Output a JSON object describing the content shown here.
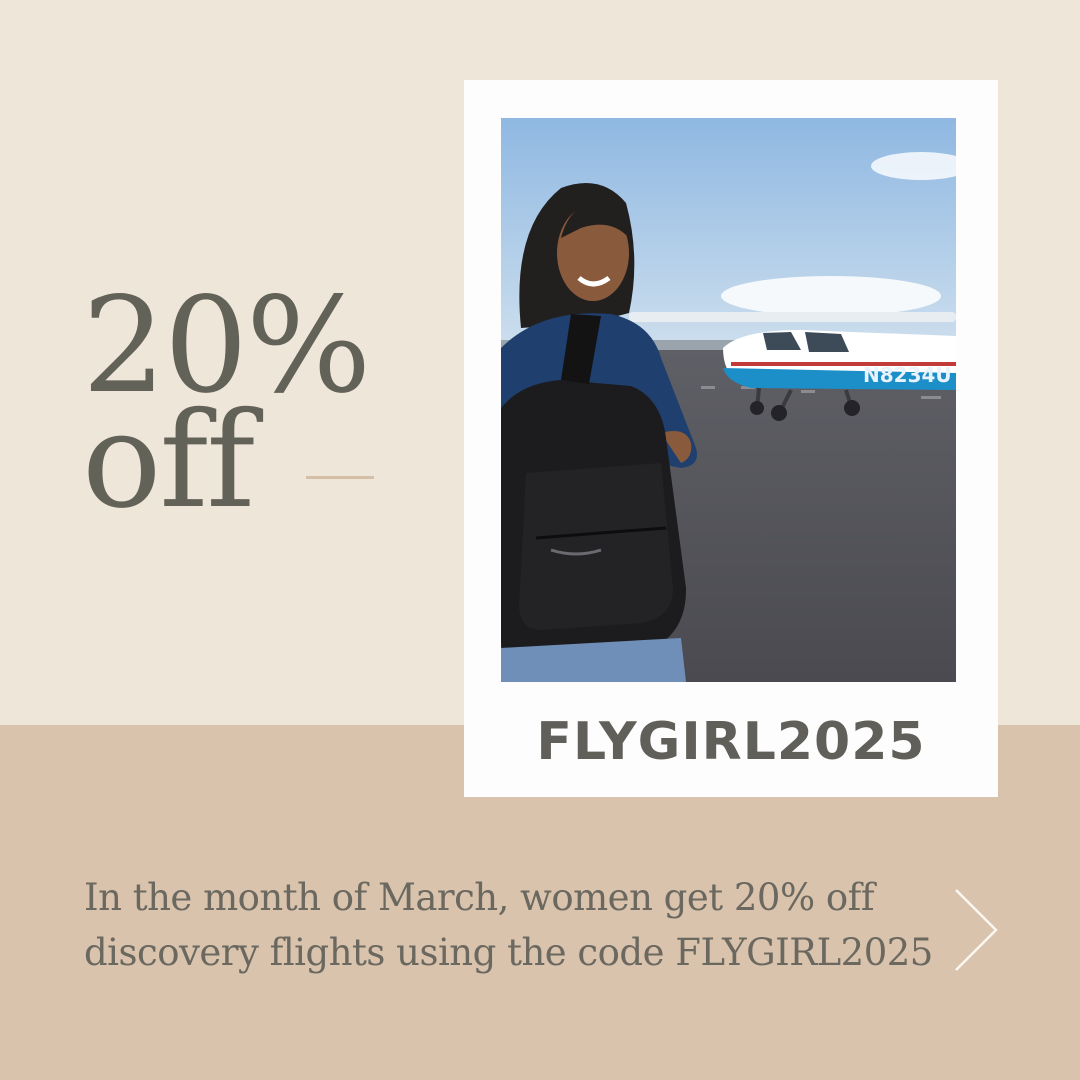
{
  "headline": {
    "line1": "20%",
    "line2": "off"
  },
  "photo": {
    "tail_number": "N8234U"
  },
  "promo": {
    "code": "FLYGIRL2025"
  },
  "caption": {
    "line1": "In the month of March, women get 20% off",
    "line2": "discovery flights using the code FLYGIRL2025"
  },
  "navigation": {
    "next_icon": "chevron-right-icon"
  },
  "colors": {
    "background_top": "#efe6da",
    "background_bottom": "#d9c3ad",
    "text": "#636259",
    "frame": "#fdfdfd"
  }
}
